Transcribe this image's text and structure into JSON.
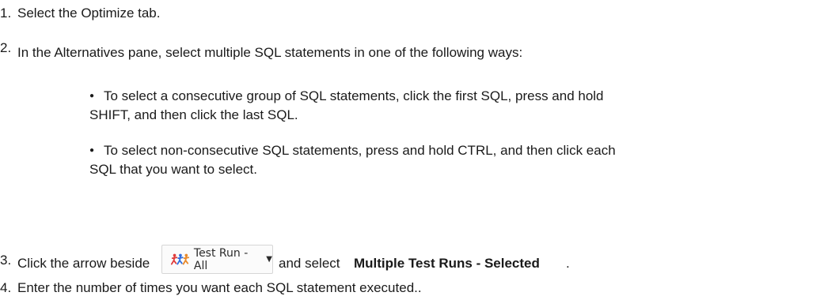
{
  "steps": [
    {
      "num": "1.",
      "text": "Select the Optimize tab."
    },
    {
      "num": "2.",
      "text": "In the Alternatives pane, select multiple SQL statements in one of the following ways:"
    },
    {
      "num": "3.",
      "pre": "Click the arrow beside",
      "mid": "and select",
      "bold": "Multiple Test Runs - Selected",
      "post": "."
    },
    {
      "num": "4.",
      "text": "Enter the number of times you want each SQL statement executed.."
    }
  ],
  "bullets": [
    {
      "line1": "To select a consecutive group of SQL statements, click the first SQL, press and hold",
      "line2": "SHIFT, and then click the last SQL."
    },
    {
      "line1": "To select non-consecutive SQL statements, press and hold CTRL, and then click each",
      "line2": "SQL that you want to select."
    }
  ],
  "button": {
    "label": "Test Run - All",
    "icon": "runners-icon",
    "arrow_icon": "dropdown-arrow-icon"
  }
}
